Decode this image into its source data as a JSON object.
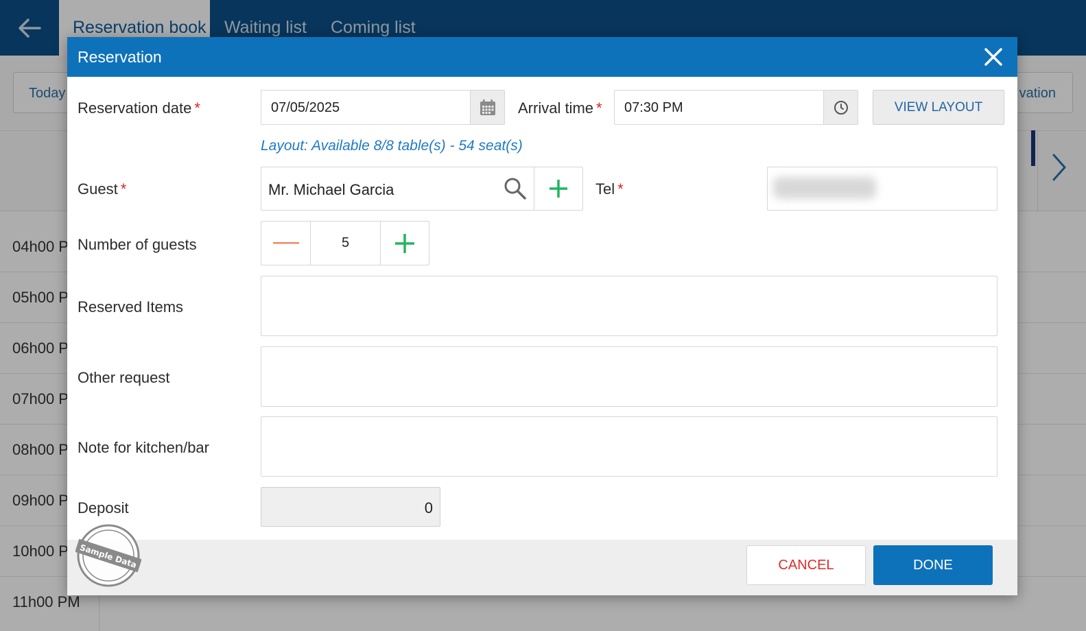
{
  "app": {
    "tabs": [
      {
        "label": "Reservation book",
        "active": true
      },
      {
        "label": "Waiting list",
        "active": false
      },
      {
        "label": "Coming list",
        "active": false
      }
    ],
    "today_label": "Today",
    "add_reservation_label": "vation",
    "time_slots": [
      "04h00 P",
      "05h00 P",
      "06h00 P",
      "07h00 P",
      "08h00 P",
      "09h00 P",
      "10h00 P",
      "11h00 PM"
    ]
  },
  "dialog": {
    "title": "Reservation",
    "reservation_date": {
      "label": "Reservation date",
      "required_mark": "*",
      "value": "07/05/2025"
    },
    "arrival_time": {
      "label": "Arrival time",
      "required_mark": "*",
      "value": "07:30 PM"
    },
    "view_layout_label": "VIEW LAYOUT",
    "layout_info": "Layout: Available 8/8 table(s) - 54 seat(s)",
    "guest": {
      "label": "Guest",
      "required_mark": "*",
      "value": "Mr. Michael Garcia"
    },
    "tel": {
      "label": "Tel",
      "required_mark": "*"
    },
    "number_of_guests": {
      "label": "Number of guests",
      "value": "5"
    },
    "reserved_items": {
      "label": "Reserved Items",
      "value": ""
    },
    "other_request": {
      "label": "Other request",
      "value": ""
    },
    "note_kitchen": {
      "label": "Note for kitchen/bar",
      "value": ""
    },
    "deposit": {
      "label": "Deposit",
      "value": "0"
    },
    "cancel_label": "CANCEL",
    "done_label": "DONE",
    "stamp_text": "Sample Data"
  },
  "colors": {
    "header_blue": "#0e72bb",
    "topbar_blue": "#0d4f86",
    "plus_green": "#1fb55f",
    "minus_orange": "#f08a5d",
    "required_red": "#e02020",
    "cancel_red": "#e02a2a"
  },
  "icons": [
    "back-arrow-icon",
    "close-icon",
    "calendar-icon",
    "clock-icon",
    "search-icon",
    "plus-icon",
    "minus-icon",
    "chevron-right-icon"
  ]
}
